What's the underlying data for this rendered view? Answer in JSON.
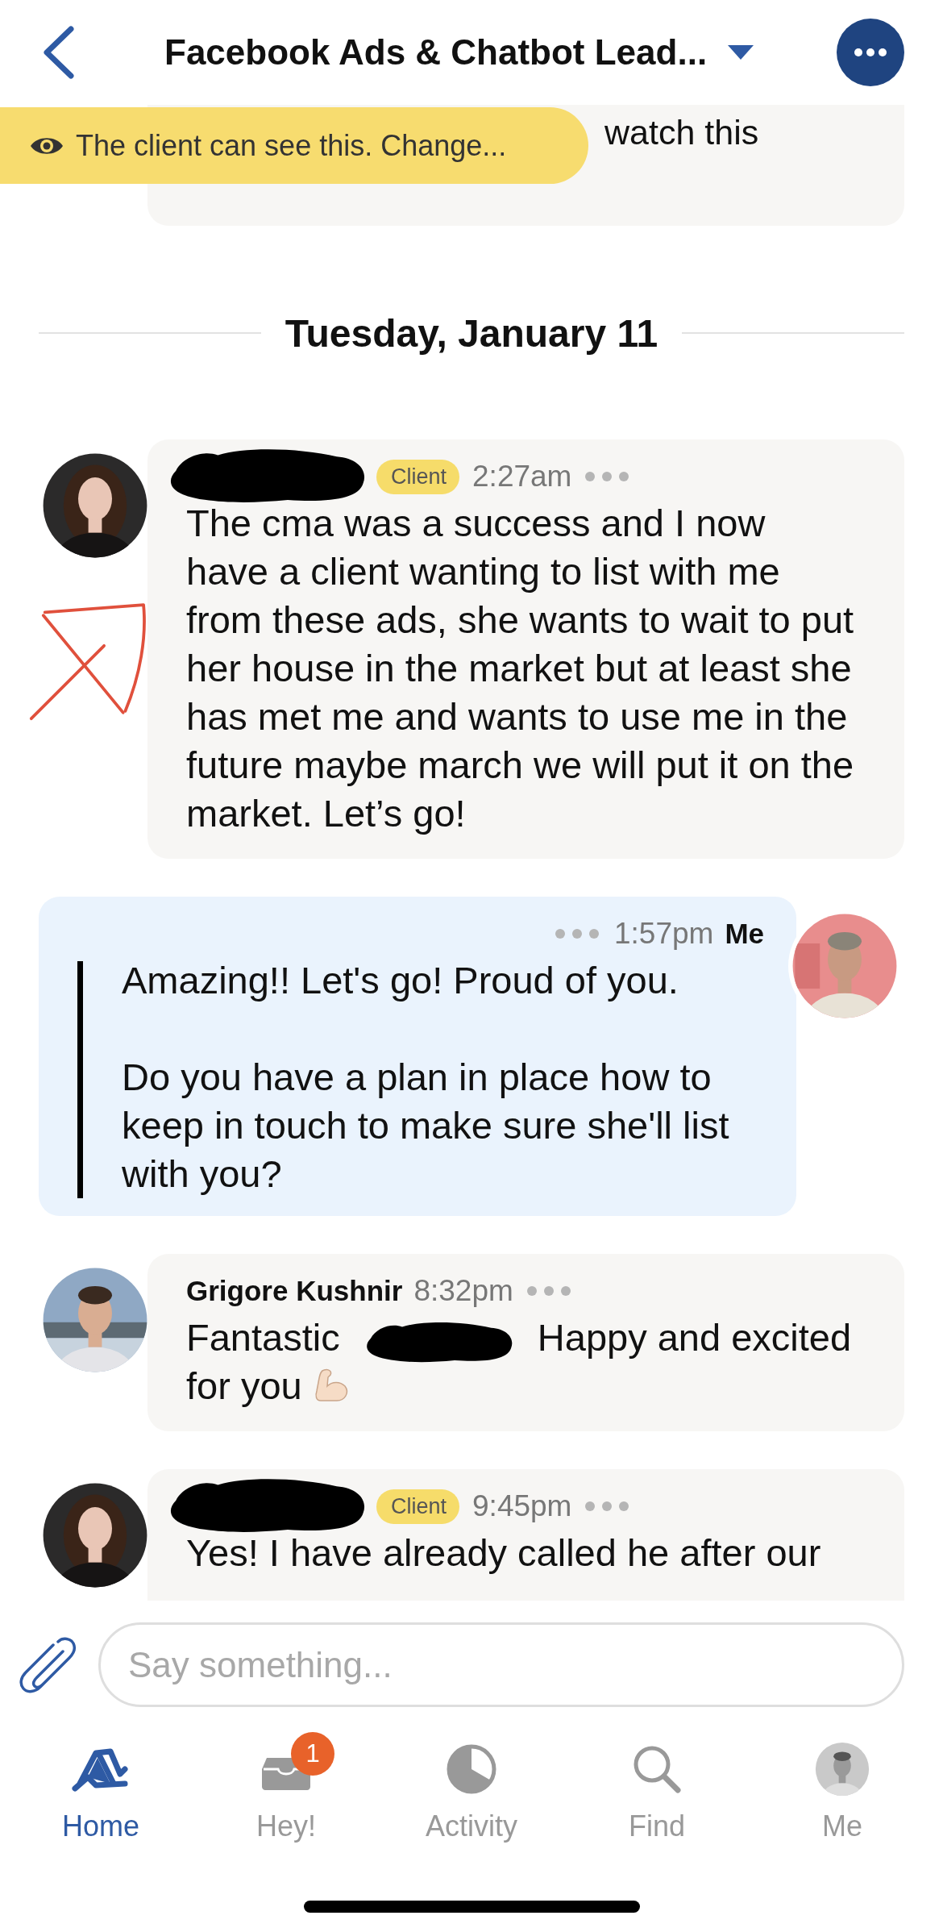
{
  "header": {
    "title": "Facebook Ads & Chatbot Lead..."
  },
  "visibility_banner": {
    "text": "The client can see this. Change..."
  },
  "previous_message": {
    "lines": [
      "watch this"
    ]
  },
  "date_divider": "Tuesday, January 11",
  "messages": [
    {
      "kind": "incoming",
      "author_redacted": true,
      "badge": "Client",
      "time": "2:27am",
      "quoted": false,
      "paragraphs": [
        [
          {
            "kind": "text",
            "text": "The cma was a success and I now have a client wanting to list with me from these ads, she wants to wait to put her house in the market but at least she has met me and wants to use me in the future maybe march we will put it on the market. Let’s go!"
          }
        ]
      ]
    },
    {
      "kind": "outgoing",
      "author": "Me",
      "time": "1:57pm",
      "quoted": true,
      "paragraphs": [
        [
          {
            "kind": "text",
            "text": "Amazing!! Let's go! Proud of you."
          }
        ],
        [
          {
            "kind": "text",
            "text": "Do you have a plan in place how to keep in touch to make sure she'll list with you?"
          }
        ]
      ]
    },
    {
      "kind": "incoming",
      "author": "Grigore Kushnir",
      "time": "8:32pm",
      "quoted": false,
      "paragraphs": [
        [
          {
            "kind": "text",
            "text": "Fantastic"
          },
          {
            "kind": "redaction"
          },
          {
            "kind": "text",
            "text": "Happy and excited"
          },
          {
            "kind": "text",
            "text": "for you"
          },
          {
            "kind": "emoji"
          }
        ]
      ]
    },
    {
      "kind": "incoming",
      "author_redacted": true,
      "badge": "Client",
      "time": "9:45pm",
      "quoted": false,
      "paragraphs": [
        [
          {
            "kind": "text",
            "text": "Yes! I have already called he after our"
          }
        ]
      ]
    }
  ],
  "composer": {
    "placeholder": "Say something..."
  },
  "tabs": [
    {
      "label": "Home",
      "selected": true
    },
    {
      "label": "Hey!",
      "selected": false,
      "badge": "1"
    },
    {
      "label": "Activity",
      "selected": false
    },
    {
      "label": "Find",
      "selected": false
    },
    {
      "label": "Me",
      "selected": false
    }
  ]
}
